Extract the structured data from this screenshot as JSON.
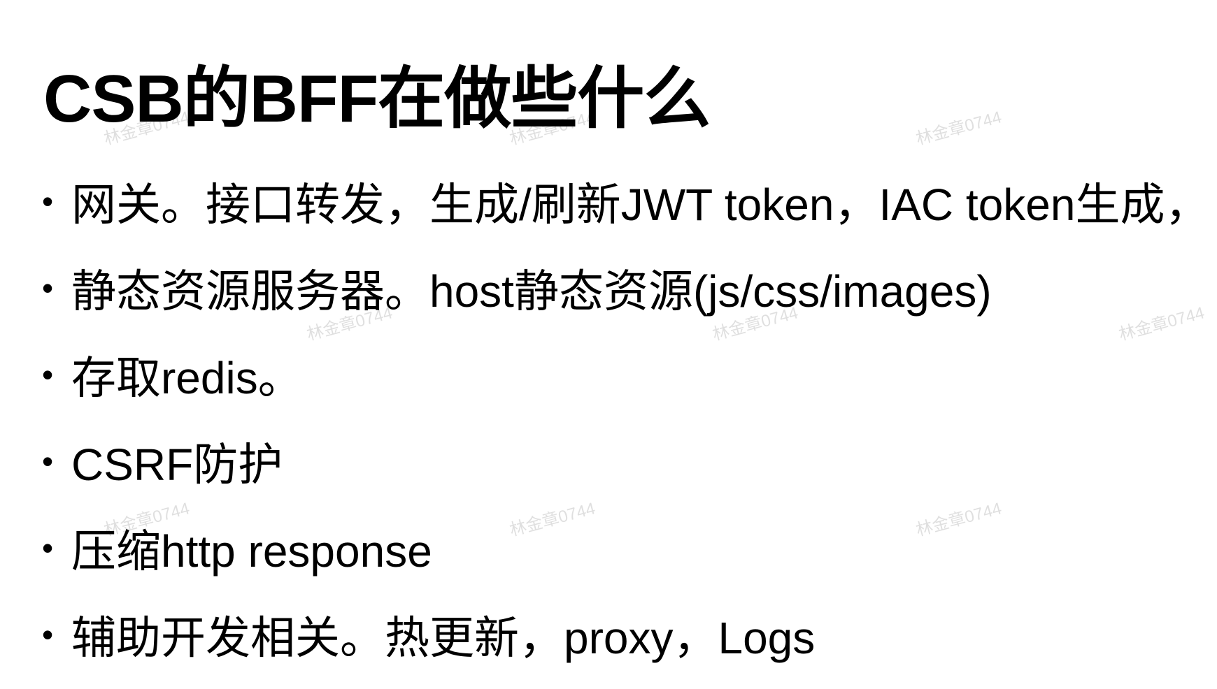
{
  "slide": {
    "title": "CSB的BFF在做些什么",
    "bullet_symbol": "•",
    "bullets": [
      {
        "text": "网关。接口转发，生成/刷新JWT token，IAC token生成，"
      },
      {
        "text": "静态资源服务器。host静态资源(js/css/images)"
      },
      {
        "text": "存取redis。"
      },
      {
        "text": "CSRF防护"
      },
      {
        "text": "压缩http response"
      },
      {
        "text": "辅助开发相关。热更新，proxy，Logs"
      }
    ]
  },
  "watermark": {
    "text": "林金章0744",
    "color": "#000000"
  }
}
